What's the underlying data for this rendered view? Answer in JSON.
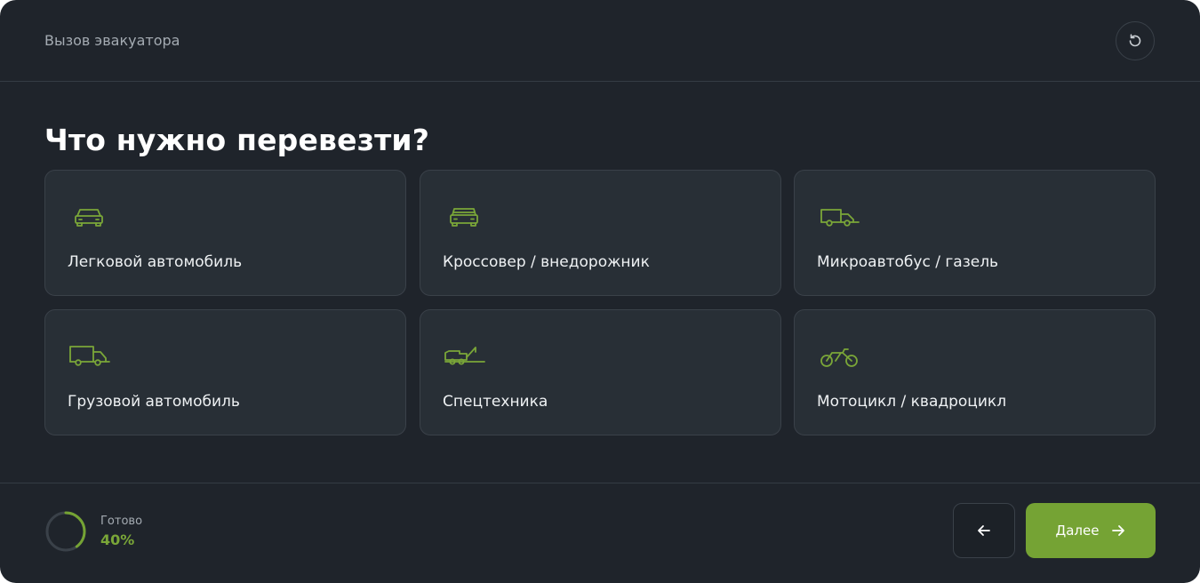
{
  "header": {
    "title": "Вызов эвакуатора",
    "reset_icon": "reset-icon"
  },
  "question": "Что нужно перевезти?",
  "options": [
    {
      "label": "Легковой автомобиль",
      "icon": "car-icon"
    },
    {
      "label": "Кроссовер / внедорожник",
      "icon": "suv-icon"
    },
    {
      "label": "Микроавтобус / газель",
      "icon": "van-icon"
    },
    {
      "label": "Грузовой автомобиль",
      "icon": "truck-icon"
    },
    {
      "label": "Спецтехника",
      "icon": "tow-truck-icon"
    },
    {
      "label": "Мотоцикл / квадроцикл",
      "icon": "motorcycle-icon"
    }
  ],
  "footer": {
    "progress_caption": "Готово",
    "progress_value": "40%",
    "progress_fraction": 0.4,
    "back_icon": "arrow-left-icon",
    "next_label": "Далее",
    "next_icon": "arrow-right-icon"
  },
  "colors": {
    "background": "#1f242b",
    "card": "#282f36",
    "accent": "#75a334",
    "accent_text": "#7aa638",
    "muted_text": "#a4abb2"
  }
}
